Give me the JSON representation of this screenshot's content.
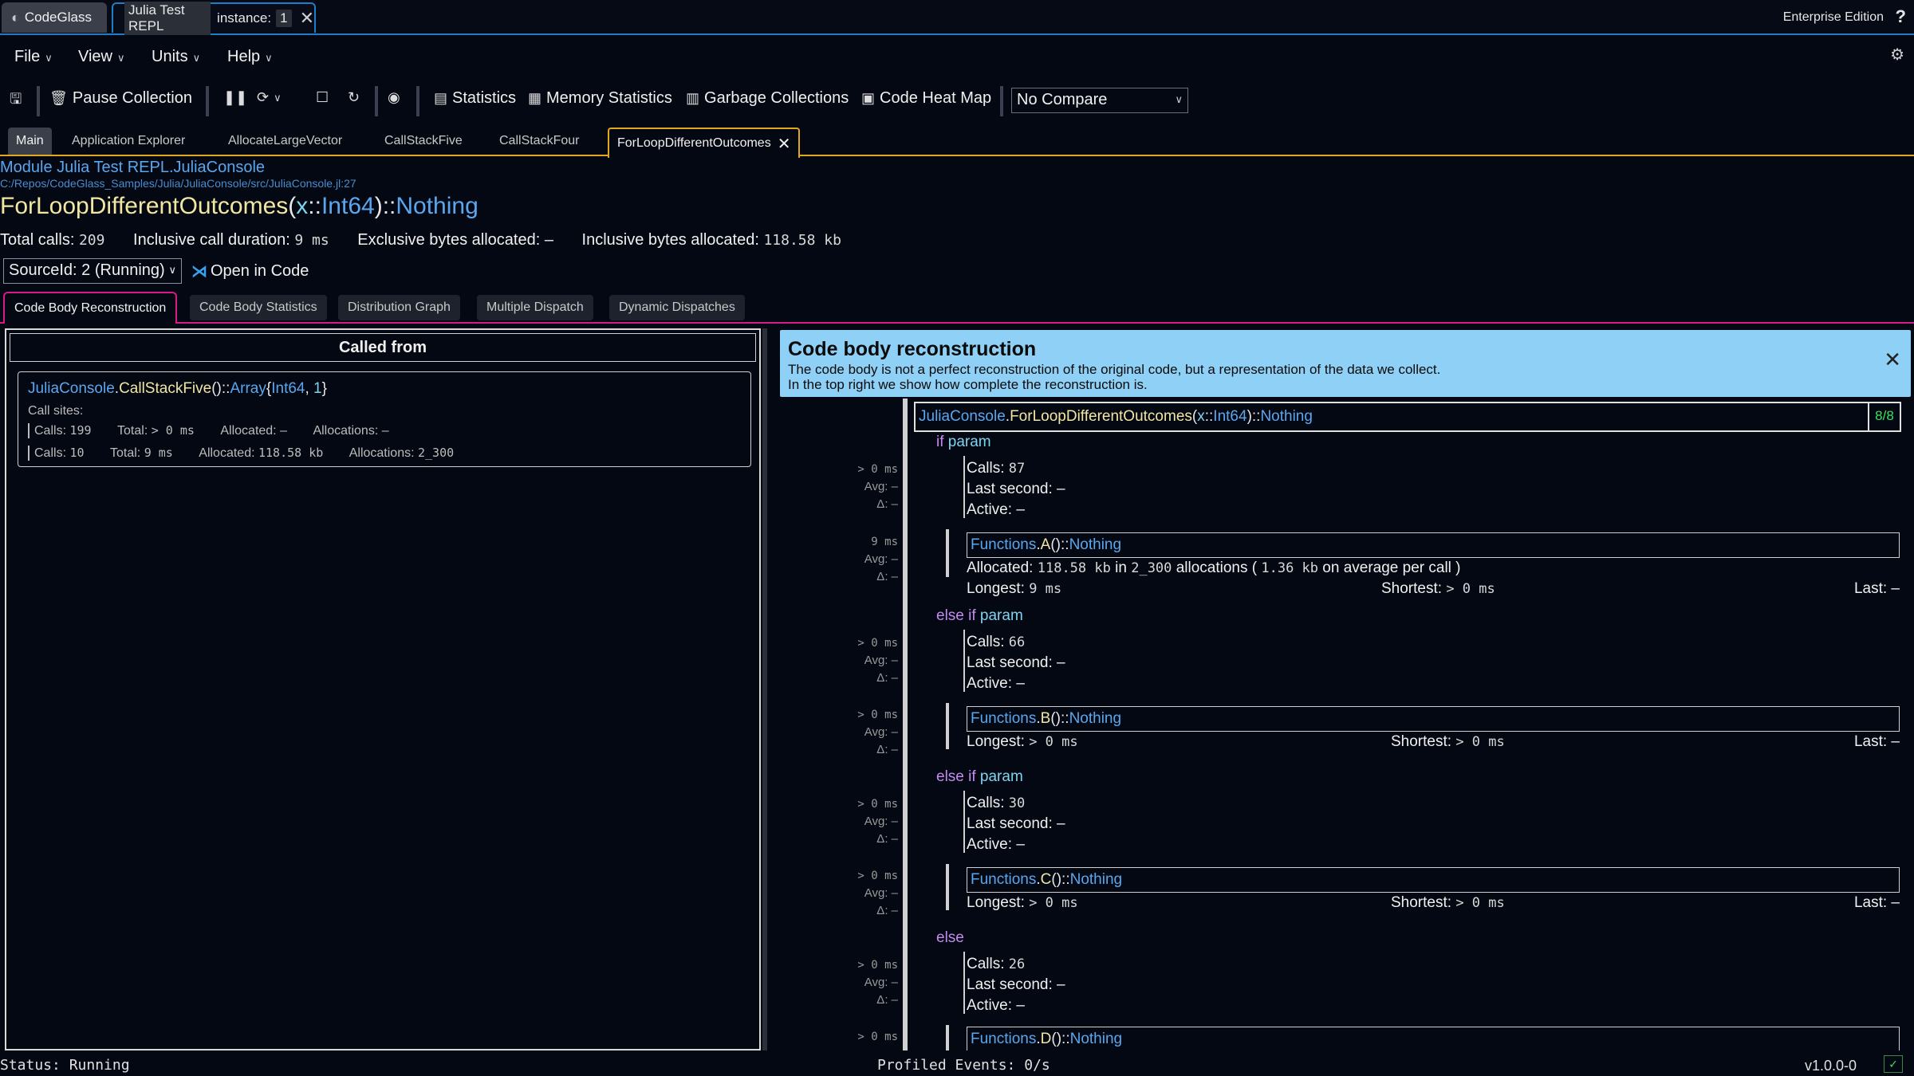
{
  "titlebar": {
    "app_tab": "CodeGlass",
    "session_tab": "Julia Test REPL",
    "instance_label": "instance:",
    "instance_value": "1",
    "edition": "Enterprise Edition",
    "help": "?"
  },
  "menu": {
    "items": [
      "File",
      "View",
      "Units",
      "Help"
    ]
  },
  "toolbar": {
    "pause_collection": "Pause Collection",
    "statistics": "Statistics",
    "memory_statistics": "Memory Statistics",
    "garbage_collections": "Garbage Collections",
    "code_heat_map": "Code Heat Map",
    "compare_value": "No Compare"
  },
  "doc_tabs": [
    "Main",
    "Application Explorer",
    "AllocateLargeVector",
    "CallStackFive",
    "CallStackFour",
    "ForLoopDifferentOutcomes"
  ],
  "header": {
    "module": "Module Julia Test REPL.JuliaConsole",
    "path": "C:/Repos/CodeGlass_Samples/Julia/JuliaConsole/src/JuliaConsole.jl:27",
    "func_name": "ForLoopDifferentOutcomes",
    "func_paren_open": "(",
    "func_arg": "x",
    "func_sep": "::",
    "func_type": "Int64",
    "func_paren_close": ")",
    "func_ret_sep": "::",
    "func_ret": "Nothing"
  },
  "stats": {
    "total_calls_label": "Total calls:",
    "total_calls": "209",
    "inclusive_duration_label": "Inclusive call duration:",
    "inclusive_duration": "9 ms",
    "exclusive_bytes_label": "Exclusive bytes allocated:",
    "exclusive_bytes": "–",
    "inclusive_bytes_label": "Inclusive bytes allocated:",
    "inclusive_bytes": "118.58 kb"
  },
  "source": {
    "value": "SourceId: 2 (Running)",
    "open_in_code": "Open in Code"
  },
  "section_tabs": [
    "Code Body Reconstruction",
    "Code Body Statistics",
    "Distribution Graph",
    "Multiple Dispatch",
    "Dynamic Dispatches"
  ],
  "called_from": {
    "header": "Called from",
    "sig_module": "JuliaConsole",
    "sig_func": "CallStackFive",
    "sig_paren": "()",
    "sig_sep": "::",
    "sig_ret": "Array",
    "sig_brace_open": "{",
    "sig_param1": "Int64",
    "sig_comma": ",",
    "sig_param2": "1",
    "sig_brace_close": "}",
    "callsites_label": "Call sites:",
    "rows": [
      {
        "calls_label": "Calls:",
        "calls": "199",
        "total_label": "Total:",
        "total": "> 0 ms",
        "allocated_label": "Allocated:",
        "allocated": "–",
        "allocations_label": "Allocations:",
        "allocations": "–"
      },
      {
        "calls_label": "Calls:",
        "calls": "10",
        "total_label": "Total:",
        "total": "9 ms",
        "allocated_label": "Allocated:",
        "allocated": "118.58 kb",
        "allocations_label": "Allocations:",
        "allocations": "2_300"
      }
    ]
  },
  "banner": {
    "title": "Code body reconstruction",
    "line1": "The code body is not a perfect reconstruction of the original code, but a representation of the data we collect.",
    "line2": "In the top right we show how complete the reconstruction is."
  },
  "reconstruction": {
    "sig_module": "JuliaConsole",
    "sig_func": "ForLoopDifferentOutcomes",
    "sig_paren_open": "(",
    "sig_arg": "x",
    "sig_sep": "::",
    "sig_type": "Int64",
    "sig_paren_close": ")",
    "sig_ret_sep": "::",
    "sig_ret": "Nothing",
    "completeness": "8/8",
    "labels": {
      "calls": "Calls:",
      "last_second": "Last second:",
      "active": "Active:",
      "allocated": "Allocated:",
      "longest": "Longest:",
      "shortest": "Shortest:",
      "last": "Last:",
      "avg": "Avg:",
      "delta": "Δ:"
    },
    "branches": [
      {
        "keyword": "if",
        "cond": "param",
        "block_time": "> 0 ms",
        "block_avg": "–",
        "block_delta": "–",
        "calls": "87",
        "last_second": "–",
        "active": "–",
        "call_time": "9 ms",
        "call_avg": "–",
        "call_delta": "–",
        "fn_module": "Functions",
        "fn_name": "A",
        "fn_paren": "()",
        "fn_sep": "::",
        "fn_ret": "Nothing",
        "alloc": "118.58 kb",
        "alloc_in": "in",
        "alloc_count": "2_300",
        "alloc_word": "allocations (",
        "alloc_avg": "1.36 kb",
        "alloc_avg_word": "on average per call )",
        "longest": "9 ms",
        "shortest": "> 0 ms",
        "last": "–"
      },
      {
        "keyword": "else if",
        "cond": "param",
        "block_time": "> 0 ms",
        "block_avg": "–",
        "block_delta": "–",
        "calls": "66",
        "last_second": "–",
        "active": "–",
        "call_time": "> 0 ms",
        "call_avg": "–",
        "call_delta": "–",
        "fn_module": "Functions",
        "fn_name": "B",
        "fn_paren": "()",
        "fn_sep": "::",
        "fn_ret": "Nothing",
        "longest": "> 0 ms",
        "shortest": "> 0 ms",
        "last": "–"
      },
      {
        "keyword": "else if",
        "cond": "param",
        "block_time": "> 0 ms",
        "block_avg": "–",
        "block_delta": "–",
        "calls": "30",
        "last_second": "–",
        "active": "–",
        "call_time": "> 0 ms",
        "call_avg": "–",
        "call_delta": "–",
        "fn_module": "Functions",
        "fn_name": "C",
        "fn_paren": "()",
        "fn_sep": "::",
        "fn_ret": "Nothing",
        "longest": "> 0 ms",
        "shortest": "> 0 ms",
        "last": "–"
      },
      {
        "keyword": "else",
        "cond": "",
        "block_time": "> 0 ms",
        "block_avg": "–",
        "block_delta": "–",
        "calls": "26",
        "last_second": "–",
        "active": "–",
        "call_time": "> 0 ms",
        "fn_module": "Functions",
        "fn_name": "D",
        "fn_paren": "()",
        "fn_sep": "::",
        "fn_ret": "Nothing"
      }
    ]
  },
  "statusbar": {
    "status": "Status: Running",
    "events": "Profiled Events: 0/s",
    "version": "v1.0.0-0",
    "check": "✓"
  }
}
